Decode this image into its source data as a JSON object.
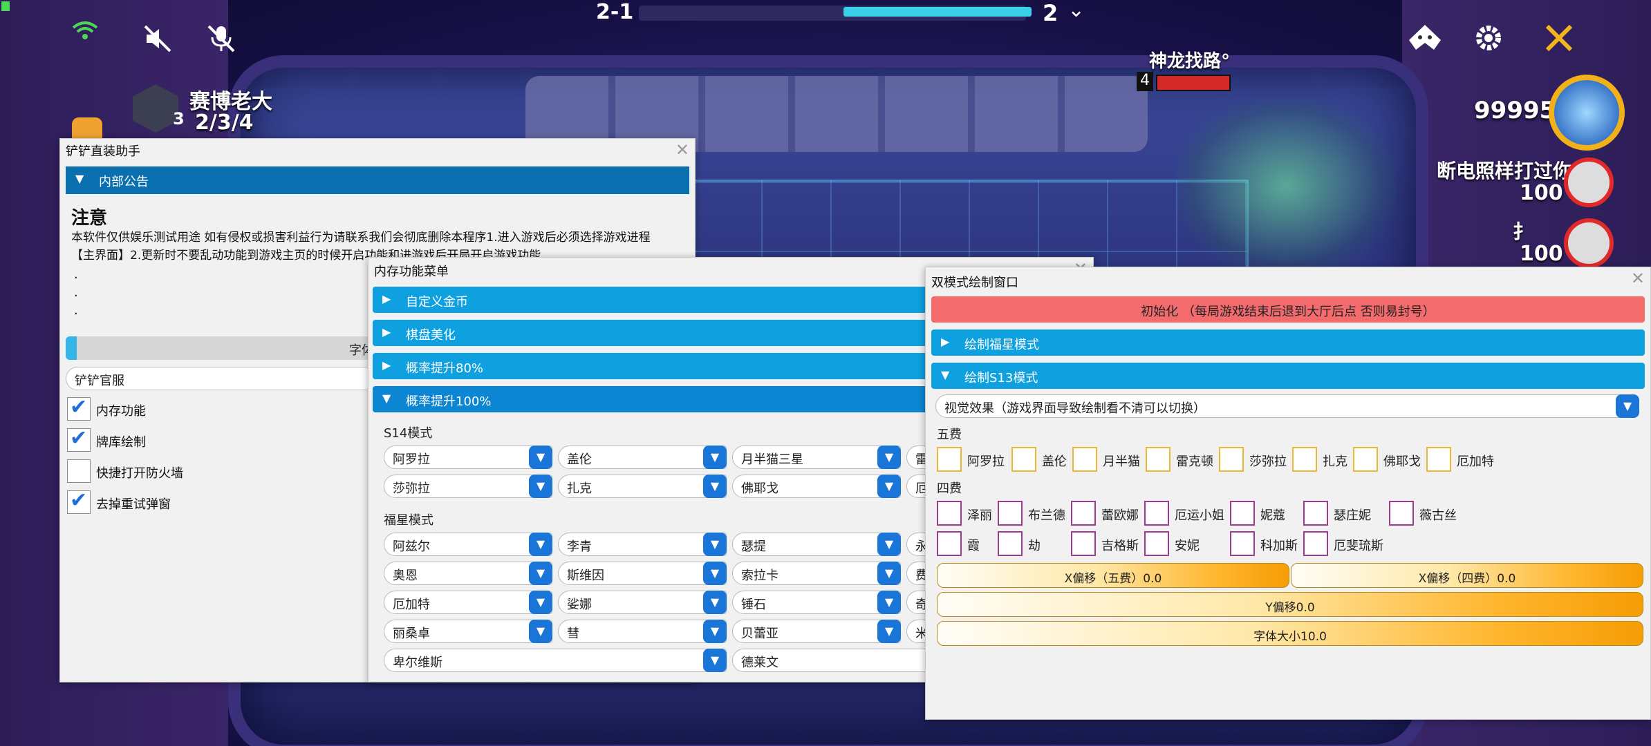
{
  "hud": {
    "round": "2-1",
    "stage": "2",
    "stage_progress": 0.49,
    "player_name": "赛博老大",
    "player_level": "3",
    "player_record": "2/3/4",
    "opponent_name": "神龙找路°",
    "opponent_level": "4",
    "score": "99995",
    "ranking": [
      {
        "name": "断电照样打过你",
        "hp": "100"
      },
      {
        "name": "扌",
        "hp": "100"
      }
    ],
    "icons": {
      "wifi": "wifi-icon",
      "battery": "battery-icon",
      "mute_speaker": "speaker-muted-icon",
      "mute_mic": "mic-muted-icon",
      "helmet": "helmet-icon",
      "settings": "gear-icon",
      "swords": "crossed-swords-icon",
      "dropdown": "chevron-down-icon"
    }
  },
  "win1": {
    "title": "铲铲直装助手",
    "section": "内部公告",
    "notice_title": "注意",
    "notice_line1": "本软件仅供娱乐测试用途 如有侵权或损害利益行为请联系我们会彻底删除本程序1.进入游戏后必须选择游戏进程",
    "notice_line2": "【主界面】2.更新时不要乱动功能到游戏主页的时候开启功能和进游戏后开局开启游戏功能",
    "dots": [
      ".",
      ".",
      "."
    ],
    "font_label": "字体",
    "server": "铲铲官服",
    "options": [
      {
        "label": "内存功能",
        "checked": true
      },
      {
        "label": "牌库绘制",
        "checked": true
      },
      {
        "label": "快捷打开防火墙",
        "checked": false
      },
      {
        "label": "去掉重试弹窗",
        "checked": true
      }
    ]
  },
  "win2": {
    "title": "内存功能菜单",
    "sections": [
      "自定义金币",
      "棋盘美化",
      "概率提升80%"
    ],
    "open_section": "概率提升100%",
    "s14_label": "S14模式",
    "s14_rows": [
      [
        "阿罗拉",
        "盖伦",
        "月半猫三星",
        "雷"
      ],
      [
        "莎弥拉",
        "扎克",
        "佛耶戈",
        "厄"
      ]
    ],
    "fuxing_label": "福星模式",
    "fuxing_rows": [
      [
        "阿兹尔",
        "李青",
        "瑟提",
        "永"
      ],
      [
        "奥恩",
        "斯维因",
        "索拉卡",
        "费"
      ],
      [
        "厄加特",
        "娑娜",
        "锤石",
        "奇"
      ],
      [
        "丽桑卓",
        "彗",
        "贝蕾亚",
        "米"
      ]
    ],
    "last_row": [
      "卑尔维斯",
      "德莱文"
    ]
  },
  "win3": {
    "title": "双模式绘制窗口",
    "init_button": "初始化 （每局游戏结束后退到大厅后点 否则易封号）",
    "section_fuxing": "绘制福星模式",
    "section_s13": "绘制S13模式",
    "visual_select": "视觉效果（游戏界面导致绘制看不清可以切换）",
    "five_cost_label": "五费",
    "five_cost": [
      "阿罗拉",
      "盖伦",
      "月半猫",
      "雷克顿",
      "莎弥拉",
      "扎克",
      "佛耶戈",
      "厄加特"
    ],
    "four_cost_label": "四费",
    "four_cost_row1": [
      "泽丽",
      "布兰德",
      "蕾欧娜",
      "厄运小姐",
      "妮蔻",
      "瑟庄妮",
      "薇古丝"
    ],
    "four_cost_row2": [
      "霞",
      "劫",
      "吉格斯",
      "安妮",
      "科加斯",
      "厄斐琉斯"
    ],
    "slider_x5": "X偏移（五费）0.0",
    "slider_x4": "X偏移（四费）0.0",
    "slider_y": "Y偏移0.0",
    "slider_font": "字体大小10.0"
  }
}
